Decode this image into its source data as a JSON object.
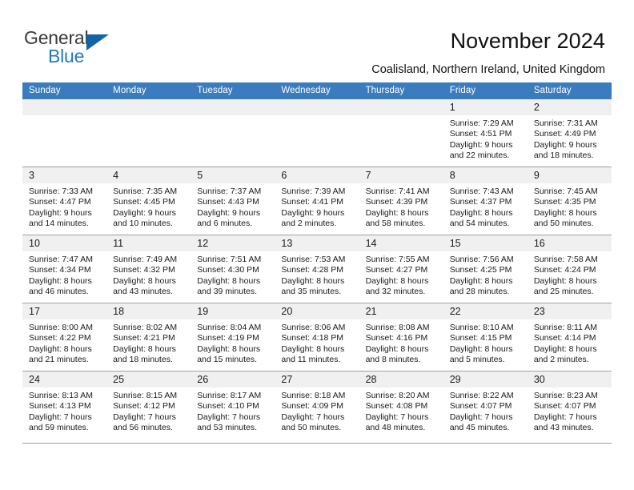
{
  "brand": {
    "word_general": "General",
    "word_blue": "Blue",
    "triangle_color": "#1464a5",
    "blue_color": "#1f7ac0"
  },
  "header": {
    "title": "November 2024",
    "subtitle": "Coalisland, Northern Ireland, United Kingdom"
  },
  "theme": {
    "header_row_bg": "#3a7cbe",
    "daynum_bg": "#f0f0f0",
    "grid_line": "#9aa0a6",
    "text": "#1a1a1a"
  },
  "weekdays": [
    "Sunday",
    "Monday",
    "Tuesday",
    "Wednesday",
    "Thursday",
    "Friday",
    "Saturday"
  ],
  "weeks": [
    [
      {
        "day": "",
        "empty": true
      },
      {
        "day": "",
        "empty": true
      },
      {
        "day": "",
        "empty": true
      },
      {
        "day": "",
        "empty": true
      },
      {
        "day": "",
        "empty": true
      },
      {
        "day": "1",
        "sunrise": "Sunrise: 7:29 AM",
        "sunset": "Sunset: 4:51 PM",
        "daylight": "Daylight: 9 hours and 22 minutes."
      },
      {
        "day": "2",
        "sunrise": "Sunrise: 7:31 AM",
        "sunset": "Sunset: 4:49 PM",
        "daylight": "Daylight: 9 hours and 18 minutes."
      }
    ],
    [
      {
        "day": "3",
        "sunrise": "Sunrise: 7:33 AM",
        "sunset": "Sunset: 4:47 PM",
        "daylight": "Daylight: 9 hours and 14 minutes."
      },
      {
        "day": "4",
        "sunrise": "Sunrise: 7:35 AM",
        "sunset": "Sunset: 4:45 PM",
        "daylight": "Daylight: 9 hours and 10 minutes."
      },
      {
        "day": "5",
        "sunrise": "Sunrise: 7:37 AM",
        "sunset": "Sunset: 4:43 PM",
        "daylight": "Daylight: 9 hours and 6 minutes."
      },
      {
        "day": "6",
        "sunrise": "Sunrise: 7:39 AM",
        "sunset": "Sunset: 4:41 PM",
        "daylight": "Daylight: 9 hours and 2 minutes."
      },
      {
        "day": "7",
        "sunrise": "Sunrise: 7:41 AM",
        "sunset": "Sunset: 4:39 PM",
        "daylight": "Daylight: 8 hours and 58 minutes."
      },
      {
        "day": "8",
        "sunrise": "Sunrise: 7:43 AM",
        "sunset": "Sunset: 4:37 PM",
        "daylight": "Daylight: 8 hours and 54 minutes."
      },
      {
        "day": "9",
        "sunrise": "Sunrise: 7:45 AM",
        "sunset": "Sunset: 4:35 PM",
        "daylight": "Daylight: 8 hours and 50 minutes."
      }
    ],
    [
      {
        "day": "10",
        "sunrise": "Sunrise: 7:47 AM",
        "sunset": "Sunset: 4:34 PM",
        "daylight": "Daylight: 8 hours and 46 minutes."
      },
      {
        "day": "11",
        "sunrise": "Sunrise: 7:49 AM",
        "sunset": "Sunset: 4:32 PM",
        "daylight": "Daylight: 8 hours and 43 minutes."
      },
      {
        "day": "12",
        "sunrise": "Sunrise: 7:51 AM",
        "sunset": "Sunset: 4:30 PM",
        "daylight": "Daylight: 8 hours and 39 minutes."
      },
      {
        "day": "13",
        "sunrise": "Sunrise: 7:53 AM",
        "sunset": "Sunset: 4:28 PM",
        "daylight": "Daylight: 8 hours and 35 minutes."
      },
      {
        "day": "14",
        "sunrise": "Sunrise: 7:55 AM",
        "sunset": "Sunset: 4:27 PM",
        "daylight": "Daylight: 8 hours and 32 minutes."
      },
      {
        "day": "15",
        "sunrise": "Sunrise: 7:56 AM",
        "sunset": "Sunset: 4:25 PM",
        "daylight": "Daylight: 8 hours and 28 minutes."
      },
      {
        "day": "16",
        "sunrise": "Sunrise: 7:58 AM",
        "sunset": "Sunset: 4:24 PM",
        "daylight": "Daylight: 8 hours and 25 minutes."
      }
    ],
    [
      {
        "day": "17",
        "sunrise": "Sunrise: 8:00 AM",
        "sunset": "Sunset: 4:22 PM",
        "daylight": "Daylight: 8 hours and 21 minutes."
      },
      {
        "day": "18",
        "sunrise": "Sunrise: 8:02 AM",
        "sunset": "Sunset: 4:21 PM",
        "daylight": "Daylight: 8 hours and 18 minutes."
      },
      {
        "day": "19",
        "sunrise": "Sunrise: 8:04 AM",
        "sunset": "Sunset: 4:19 PM",
        "daylight": "Daylight: 8 hours and 15 minutes."
      },
      {
        "day": "20",
        "sunrise": "Sunrise: 8:06 AM",
        "sunset": "Sunset: 4:18 PM",
        "daylight": "Daylight: 8 hours and 11 minutes."
      },
      {
        "day": "21",
        "sunrise": "Sunrise: 8:08 AM",
        "sunset": "Sunset: 4:16 PM",
        "daylight": "Daylight: 8 hours and 8 minutes."
      },
      {
        "day": "22",
        "sunrise": "Sunrise: 8:10 AM",
        "sunset": "Sunset: 4:15 PM",
        "daylight": "Daylight: 8 hours and 5 minutes."
      },
      {
        "day": "23",
        "sunrise": "Sunrise: 8:11 AM",
        "sunset": "Sunset: 4:14 PM",
        "daylight": "Daylight: 8 hours and 2 minutes."
      }
    ],
    [
      {
        "day": "24",
        "sunrise": "Sunrise: 8:13 AM",
        "sunset": "Sunset: 4:13 PM",
        "daylight": "Daylight: 7 hours and 59 minutes."
      },
      {
        "day": "25",
        "sunrise": "Sunrise: 8:15 AM",
        "sunset": "Sunset: 4:12 PM",
        "daylight": "Daylight: 7 hours and 56 minutes."
      },
      {
        "day": "26",
        "sunrise": "Sunrise: 8:17 AM",
        "sunset": "Sunset: 4:10 PM",
        "daylight": "Daylight: 7 hours and 53 minutes."
      },
      {
        "day": "27",
        "sunrise": "Sunrise: 8:18 AM",
        "sunset": "Sunset: 4:09 PM",
        "daylight": "Daylight: 7 hours and 50 minutes."
      },
      {
        "day": "28",
        "sunrise": "Sunrise: 8:20 AM",
        "sunset": "Sunset: 4:08 PM",
        "daylight": "Daylight: 7 hours and 48 minutes."
      },
      {
        "day": "29",
        "sunrise": "Sunrise: 8:22 AM",
        "sunset": "Sunset: 4:07 PM",
        "daylight": "Daylight: 7 hours and 45 minutes."
      },
      {
        "day": "30",
        "sunrise": "Sunrise: 8:23 AM",
        "sunset": "Sunset: 4:07 PM",
        "daylight": "Daylight: 7 hours and 43 minutes."
      }
    ]
  ]
}
